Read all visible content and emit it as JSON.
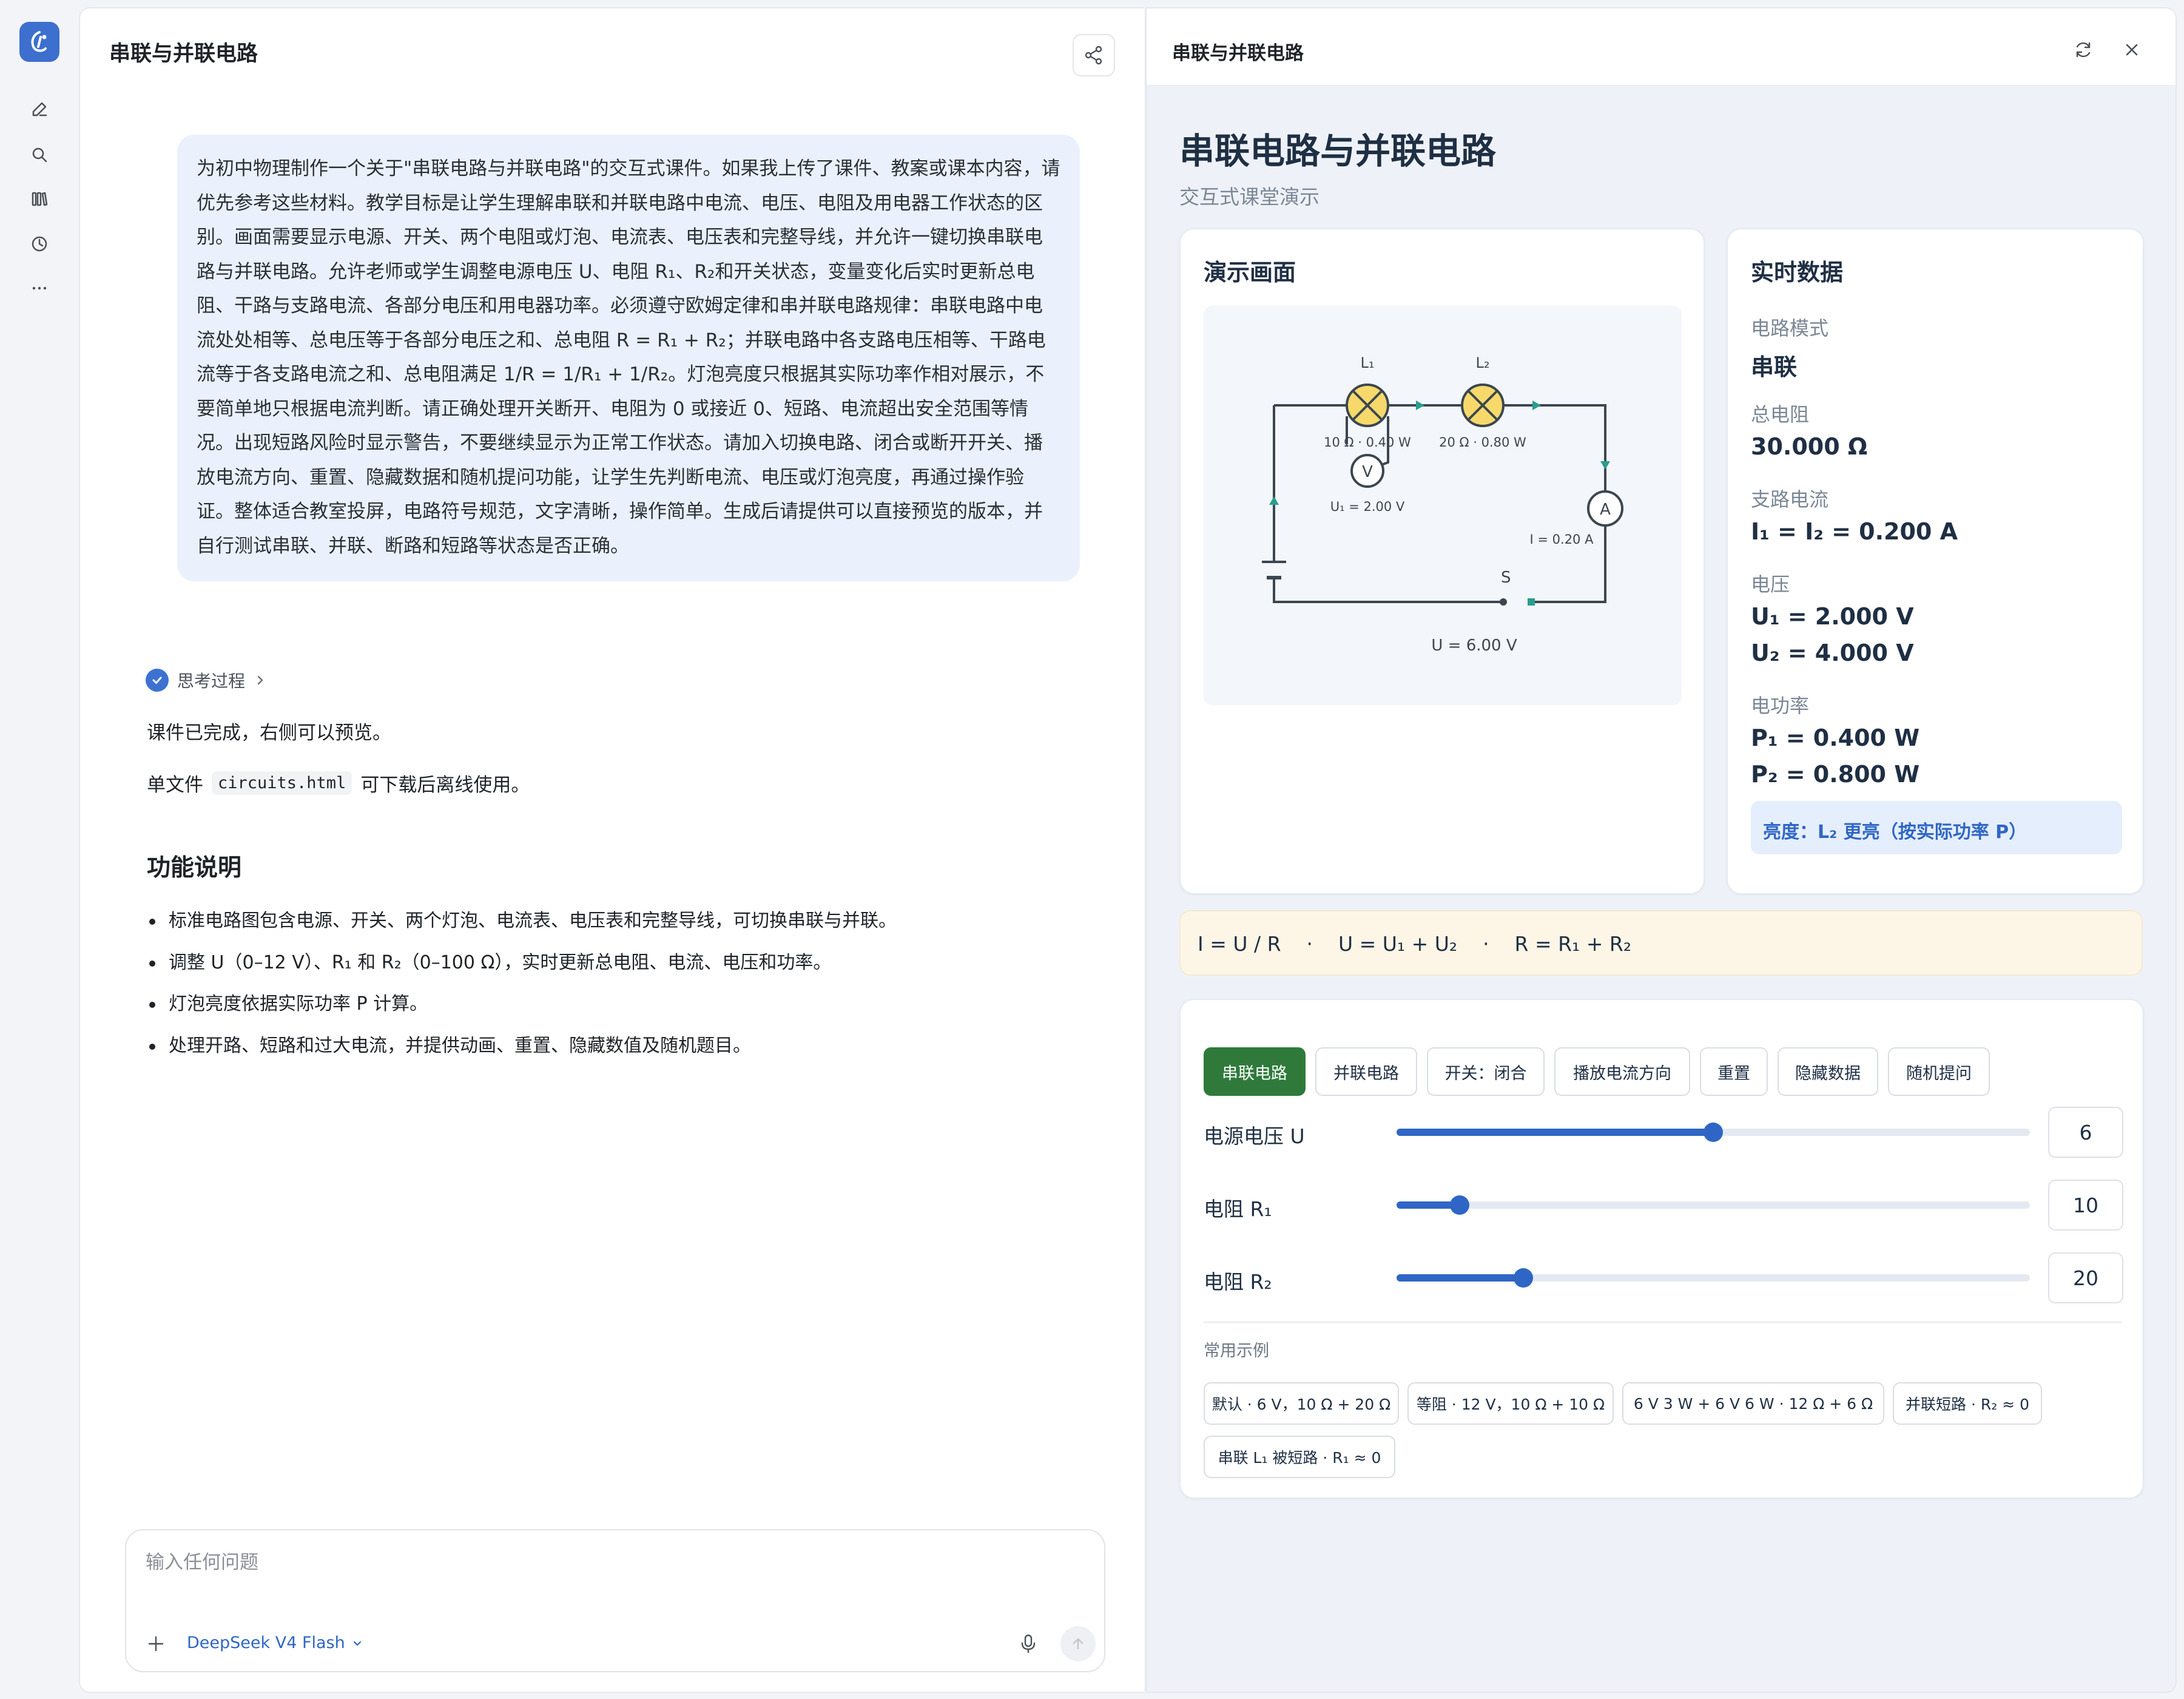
{
  "chat": {
    "title": "串联与并联电路",
    "user_prompt": "为初中物理制作一个关于\"串联电路与并联电路\"的交互式课件。如果我上传了课件、教案或课本内容，请优先参考这些材料。教学目标是让学生理解串联和并联电路中电流、电压、电阻及用电器工作状态的区别。画面需要显示电源、开关、两个电阻或灯泡、电流表、电压表和完整导线，并允许一键切换串联电路与并联电路。允许老师或学生调整电源电压 U、电阻 R₁、R₂和开关状态，变量变化后实时更新总电阻、干路与支路电流、各部分电压和用电器功率。必须遵守欧姆定律和串并联电路规律：串联电路中电流处处相等、总电压等于各部分电压之和、总电阻 R = R₁ + R₂；并联电路中各支路电压相等、干路电流等于各支路电流之和、总电阻满足 1/R = 1/R₁ + 1/R₂。灯泡亮度只根据其实际功率作相对展示，不要简单地只根据电流判断。请正确处理开关断开、电阻为 0 或接近 0、短路、电流超出安全范围等情况。出现短路风险时显示警告，不要继续显示为正常工作状态。请加入切换电路、闭合或断开开关、播放电流方向、重置、隐藏数据和随机提问功能，让学生先判断电流、电压或灯泡亮度，再通过操作验证。整体适合教室投屏，电路符号规范，文字清晰，操作简单。生成后请提供可以直接预览的版本，并自行测试串联、并联、断路和短路等状态是否正确。",
    "thinking_label": "思考过程",
    "answer_line1": "课件已完成，右侧可以预览。",
    "answer_line2_prefix": "单文件",
    "answer_line2_code": "circuits.html",
    "answer_line2_suffix": "可下载后离线使用。",
    "features_heading": "功能说明",
    "features": [
      "标准电路图包含电源、开关、两个灯泡、电流表、电压表和完整导线，可切换串联与并联。",
      "调整 U（0–12 V）、R₁ 和 R₂（0–100 Ω），实时更新总电阻、电流、电压和功率。",
      "灯泡亮度依据实际功率 P 计算。",
      "处理开路、短路和过大电流，并提供动画、重置、隐藏数值及随机题目。"
    ],
    "composer": {
      "placeholder": "输入任何问题",
      "model": "DeepSeek V4 Flash"
    }
  },
  "preview": {
    "header_title": "串联与并联电路",
    "page_title": "串联电路与并联电路",
    "page_subtitle": "交互式课堂演示",
    "demo_heading": "演示画面",
    "circuit": {
      "lamp1_name": "L₁",
      "lamp2_name": "L₂",
      "lamp1_info": "10 Ω · 0.40 W",
      "lamp2_info": "20 Ω · 0.80 W",
      "voltmeter_symbol": "V",
      "voltmeter_reading": "U₁ = 2.00 V",
      "ammeter_symbol": "A",
      "ammeter_reading": "I = 0.20 A",
      "switch_label": "S",
      "source_voltage": "U = 6.00 V"
    },
    "realtime": {
      "heading": "实时数据",
      "mode_label": "电路模式",
      "mode_value": "串联",
      "resistance_label": "总电阻",
      "resistance_value": "30.000 Ω",
      "current_label": "支路电流",
      "current_value": "I₁ = I₂ = 0.200 A",
      "voltage_label": "电压",
      "voltage_u1": "U₁ = 2.000 V",
      "voltage_u2": "U₂ = 4.000 V",
      "power_label": "电功率",
      "power_p1": "P₁ = 0.400 W",
      "power_p2": "P₂ = 0.800 W",
      "brightness": "亮度：L₂ 更亮（按实际功率 P）"
    },
    "formula": "I = U / R    ·    U = U₁ + U₂    ·    R = R₁ + R₂",
    "buttons": {
      "series": "串联电路",
      "parallel": "并联电路",
      "switch": "开关：闭合",
      "play": "播放电流方向",
      "reset": "重置",
      "hide": "隐藏数据",
      "quiz": "随机提问"
    },
    "sliders": [
      {
        "label": "电源电压 U",
        "value": "6",
        "min": 0,
        "max": 12,
        "fraction": 0.5
      },
      {
        "label": "电阻 R₁",
        "value": "10",
        "min": 0,
        "max": 100,
        "fraction": 0.1
      },
      {
        "label": "电阻 R₂",
        "value": "20",
        "min": 0,
        "max": 100,
        "fraction": 0.2
      }
    ],
    "examples_label": "常用示例",
    "examples": [
      "默认 · 6 V，10 Ω + 20 Ω",
      "等阻 · 12 V，10 Ω + 10 Ω",
      "6 V 3 W + 6 V 6 W · 12 Ω + 6 Ω",
      "并联短路 · R₂ ≈ 0",
      "串联 L₁ 被短路 · R₁ ≈ 0"
    ]
  },
  "colors": {
    "accent_blue": "#2f66c5",
    "active_green": "#2f7a3b",
    "lamp_yellow": "#f7d96b",
    "wire": "#3b4650",
    "current_arrow": "#2a9d8f"
  }
}
